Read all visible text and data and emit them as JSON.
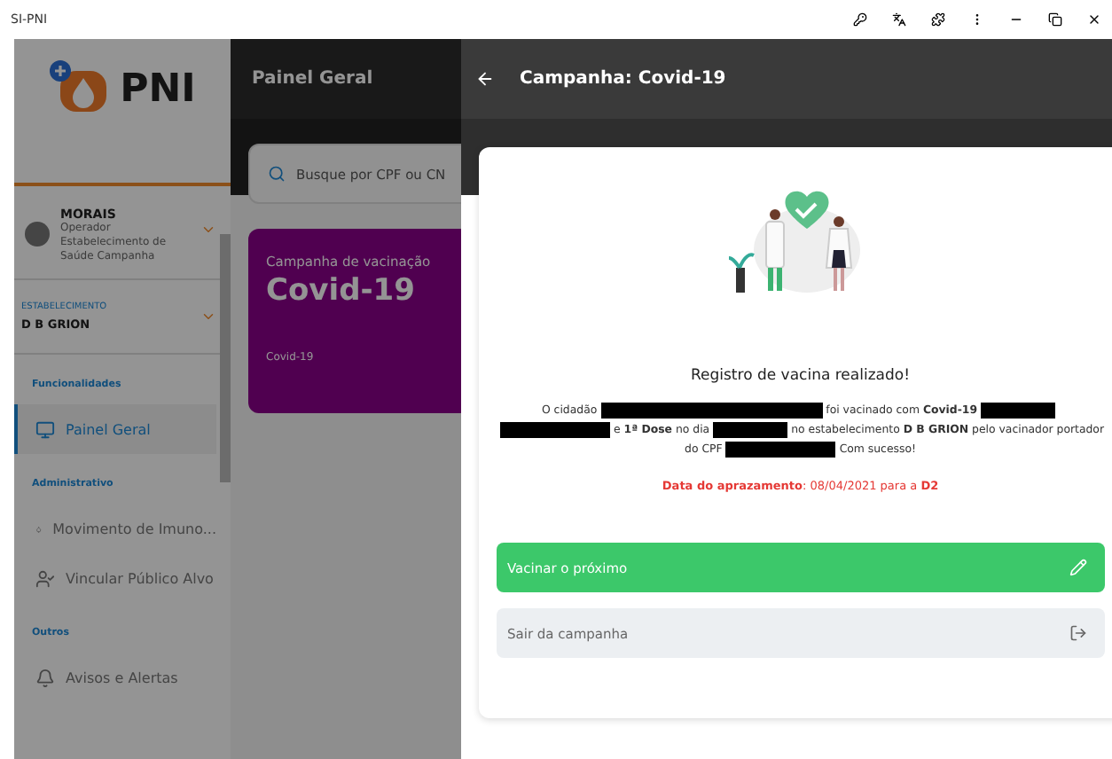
{
  "browser": {
    "title": "SI-PNI"
  },
  "sidebar": {
    "logo_text": "PNI",
    "user": {
      "name": "MORAIS",
      "role": "Operador",
      "unit": "Estabelecimento de Saúde Campanha"
    },
    "establishment": {
      "label": "ESTABELECIMENTO",
      "value": "D B GRION"
    },
    "sections": [
      {
        "title": "Funcionalidades",
        "items": [
          {
            "label": "Painel Geral",
            "selected": true
          }
        ]
      },
      {
        "title": "Administrativo",
        "items": [
          {
            "label": "Movimento de Imuno...",
            "selected": false
          },
          {
            "label": "Vincular Público Alvo",
            "selected": false
          }
        ]
      },
      {
        "title": "Outros",
        "items": [
          {
            "label": "Avisos e Alertas",
            "selected": false
          }
        ]
      }
    ]
  },
  "main": {
    "title": "Painel Geral",
    "search": {
      "placeholder": "Busque por CPF ou CN"
    },
    "campaign_card": {
      "label": "Campanha de vacinação",
      "name": "Covid-19",
      "footer": "Covid-19"
    }
  },
  "drawer": {
    "title": "Campanha: Covid-19",
    "heading": "Registro de vacina realizado!",
    "message_lines": [
      [
        {
          "kind": "text",
          "text": "O cidadão"
        },
        {
          "kind": "redacted_long"
        },
        {
          "kind": "text",
          "text": "foi vacinado com **Covid-19**"
        },
        {
          "kind": "redacted_short"
        }
      ],
      [
        {
          "kind": "redacted_medium"
        },
        {
          "kind": "text",
          "text": "e **1ª Dose** no dia"
        },
        {
          "kind": "redacted_short"
        },
        {
          "kind": "text",
          "text": "no estabelecimento **D B GRION** pelo vacinador portador"
        }
      ],
      [
        {
          "kind": "text",
          "text": "do CPF"
        },
        {
          "kind": "redacted_medium"
        },
        {
          "kind": "text",
          "text": "Com sucesso!"
        }
      ]
    ],
    "schedule": "**Data do aprazamento**: 08/04/2021 para a **D2**",
    "actions": [
      {
        "label": "Vacinar o próximo",
        "kind": "primary"
      },
      {
        "label": "Sair da campanha",
        "kind": "secondary"
      }
    ]
  }
}
